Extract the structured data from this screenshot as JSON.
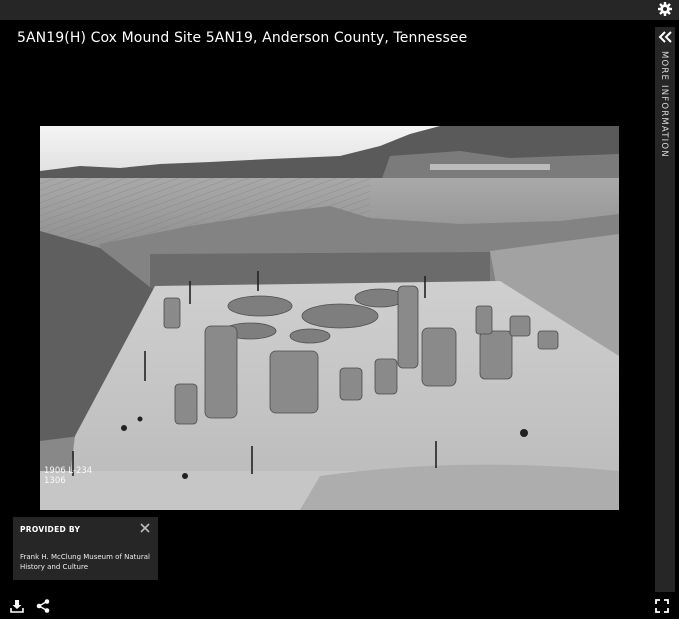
{
  "title": "5AN19(H) Cox Mound Site 5AN19, Anderson County, Tennessee",
  "side_panel": {
    "label": "MORE INFORMATION"
  },
  "provided_by": {
    "heading": "PROVIDED BY",
    "text": "Frank H. McClung Museum of Natural History and Culture"
  },
  "photo": {
    "caption": "1906 L-234\n1306"
  },
  "icons": {
    "settings": "gear-icon",
    "collapse": "double-chevron-left-icon",
    "close": "close-icon",
    "download": "download-icon",
    "share": "share-icon",
    "fullscreen": "fullscreen-icon"
  }
}
